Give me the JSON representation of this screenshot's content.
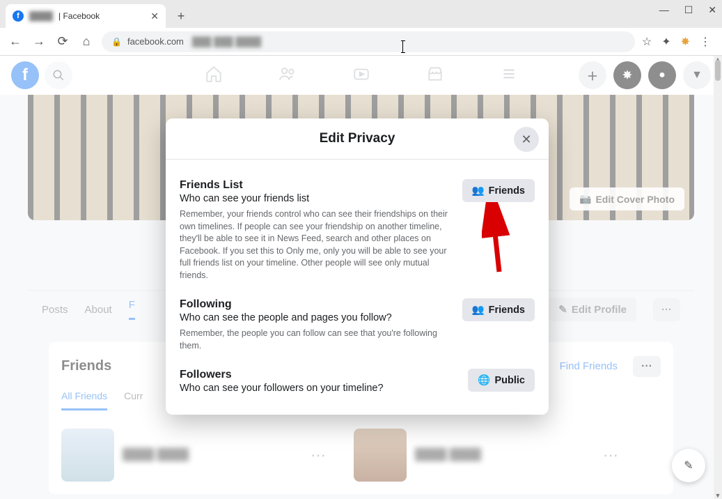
{
  "browser": {
    "tab_title_suffix": "| Facebook",
    "url_host": "facebook.com",
    "window_controls": {
      "min": "—",
      "max": "☐",
      "close": "✕"
    }
  },
  "fb_nav": {
    "right": {
      "create": "+",
      "messenger": "✱",
      "notif": "●",
      "account": "▼"
    }
  },
  "cover": {
    "edit_label": "Edit Cover Photo"
  },
  "profile_tabs": {
    "posts": "Posts",
    "about": "About",
    "friends_initial": "F",
    "edit_profile": "Edit Profile"
  },
  "friends_card": {
    "title": "Friends",
    "find": "Find Friends",
    "tabs": {
      "all": "All Friends",
      "current": "Curr"
    }
  },
  "modal": {
    "title": "Edit Privacy",
    "sections": [
      {
        "heading": "Friends List",
        "subtitle": "Who can see your friends list",
        "desc": "Remember, your friends control who can see their friendships on their own timelines. If people can see your friendship on another timeline, they'll be able to see it in News Feed, search and other places on Facebook. If you set this to Only me, only you will be able to see your full friends list on your timeline. Other people will see only mutual friends.",
        "chip": "Friends",
        "chip_icon": "friends"
      },
      {
        "heading": "Following",
        "subtitle": "Who can see the people and pages you follow?",
        "desc": "Remember, the people you can follow can see that you're following them.",
        "chip": "Friends",
        "chip_icon": "friends"
      },
      {
        "heading": "Followers",
        "subtitle": "Who can see your followers on your timeline?",
        "desc": "",
        "chip": "Public",
        "chip_icon": "globe"
      }
    ]
  }
}
